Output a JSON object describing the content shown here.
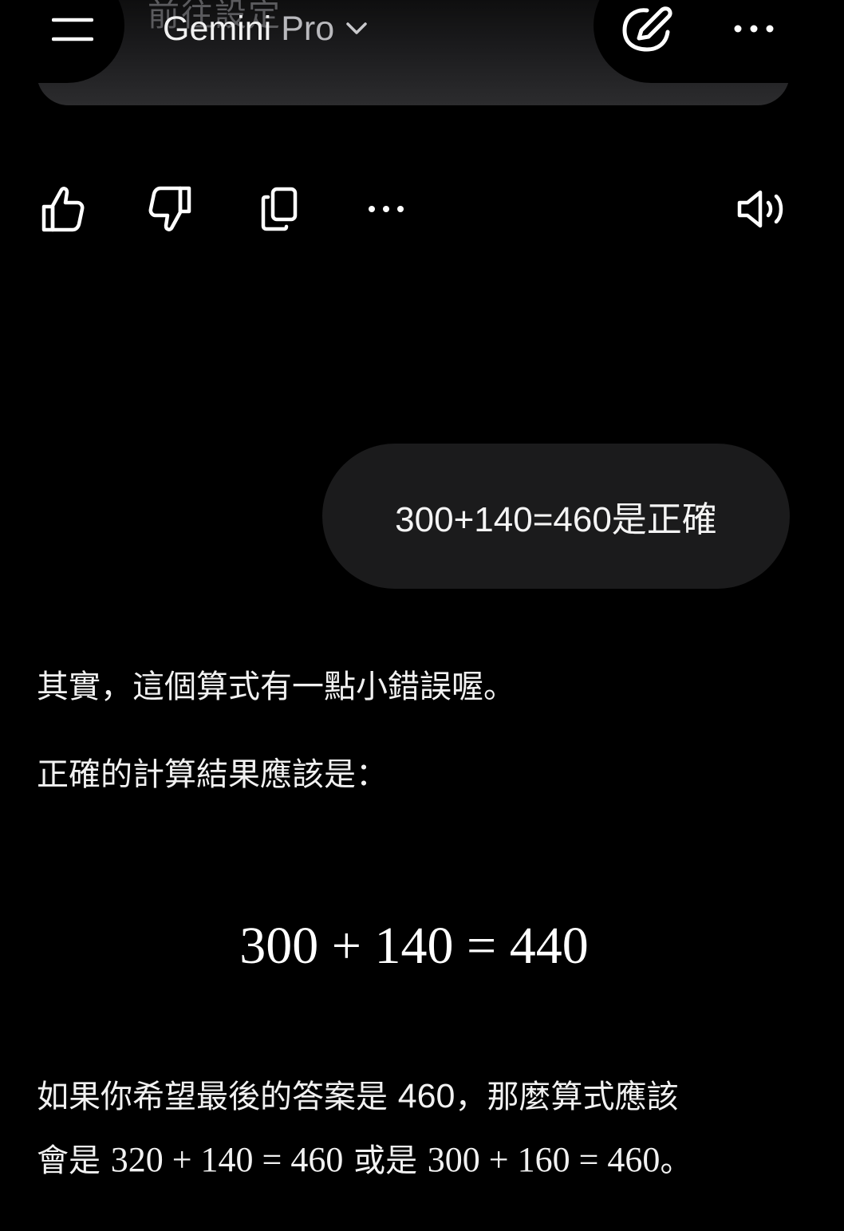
{
  "header": {
    "ghost_text": "前往設定",
    "model_name": "Gemini",
    "model_tier": "Pro",
    "icons": {
      "menu": "hamburger-menu-icon",
      "model_dropdown": "chevron-down-icon",
      "new_chat": "edit-pencil-icon",
      "more": "more-horizontal-icon"
    }
  },
  "response_actions": {
    "icons": [
      "thumbs-up-icon",
      "thumbs-down-icon",
      "copy-icon",
      "more-horizontal-icon",
      "speaker-icon"
    ]
  },
  "user_message": {
    "text": "300+140=460是正確"
  },
  "response": {
    "line1": "其實，這個算式有一點小錯誤喔。",
    "line2": "正確的計算結果應該是：",
    "math_display": "300 + 140 = 440",
    "para_line1_prefix": "如果你希望最後的答案是 ",
    "para_line1_number": "460",
    "para_line1_suffix": "，那麼算式應該",
    "para_line2_prefix": "會是 ",
    "para_line2_math1": "320 + 140 = 460",
    "para_line2_middle": " 或是 ",
    "para_line2_math2": "300 + 160 = 460",
    "para_line2_suffix": "。"
  },
  "colors": {
    "background": "#000000",
    "bubble": "#1b1b1c",
    "text": "#f1f1f1",
    "muted": "#b9b9bd"
  }
}
